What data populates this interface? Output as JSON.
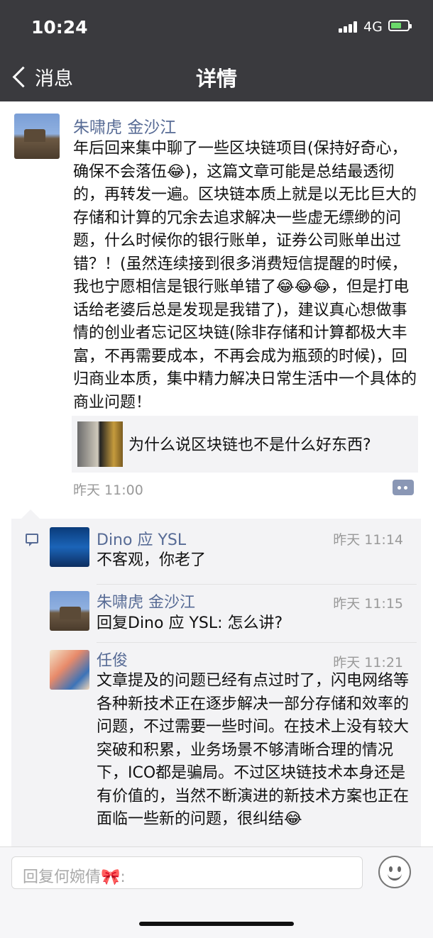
{
  "status_bar": {
    "time": "10:24",
    "network": "4G"
  },
  "nav": {
    "back_label": "消息",
    "title": "详情"
  },
  "post": {
    "author": "朱啸虎  金沙江",
    "body": "年后回来集中聊了一些区块链项目(保持好奇心，确保不会落伍😂)，这篇文章可能是总结最透彻的，再转发一遍。区块链本质上就是以无比巨大的存储和计算的冗余去追求解决一些虚无缥缈的问题，什么时候你的银行账单，证券公司账单出过错？！(虽然连续接到很多消费短信提醒的时候，我也宁愿相信是银行账单错了😂😂😂，但是打电话给老婆后总是发现是我错了)，建议真心想做事情的创业者忘记区块链(除非存储和计算都极大丰富，不再需要成本，不再会成为瓶颈的时候)，回归商业本质，集中精力解决日常生活中一个具体的商业问题！",
    "shared_link_title": "为什么说区块链也不是什么好东西?",
    "time": "昨天 11:00"
  },
  "comments": [
    {
      "name": "Dino 应 YSL",
      "time": "昨天 11:14",
      "text": "不客观，你老了"
    },
    {
      "name": "朱啸虎  金沙江",
      "time": "昨天 11:15",
      "text": "回复Dino 应 YSL: 怎么讲?"
    },
    {
      "name": "任俊",
      "time": "昨天 11:21",
      "text": "文章提及的问题已经有点过时了，闪电网络等各种新技术正在逐步解决一部分存储和效率的问题，不过需要一些时间。在技术上没有较大突破和积累，业务场景不够清晰合理的情况下，ICO都是骗局。不过区块链技术本身还是有价值的，当然不断演进的新技术方案也正在面临一些新的问题，很纠结😂"
    }
  ],
  "reply": {
    "placeholder": "回复何婉倩",
    "placeholder_emoji": "🎀",
    "placeholder_suffix": ":"
  },
  "colors": {
    "header_bg": "#3a3a3e",
    "name_link": "#576b95",
    "comment_bg": "#f3f3f5"
  }
}
